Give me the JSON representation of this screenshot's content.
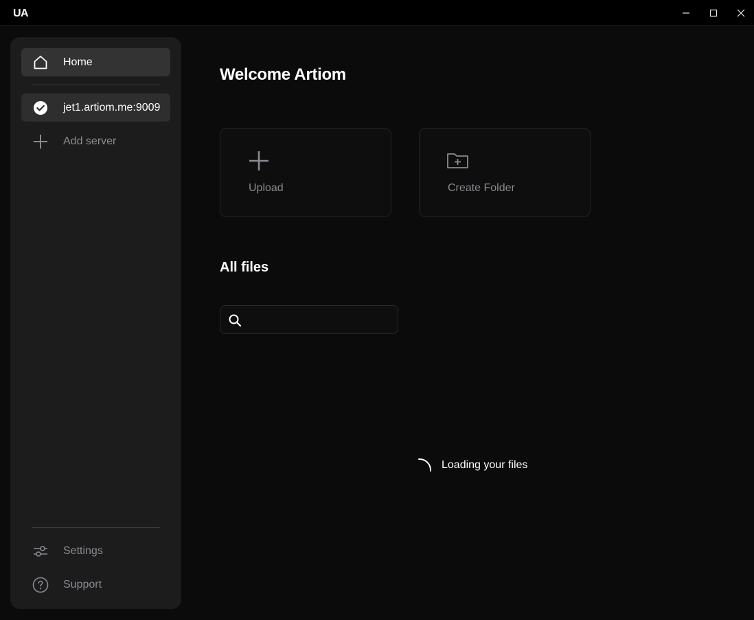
{
  "app": {
    "logo": "UA",
    "window_controls": [
      "minimize-icon",
      "maximize-icon",
      "close-icon"
    ]
  },
  "sidebar": {
    "home": {
      "label": "Home",
      "icon": "home-icon"
    },
    "servers": [
      {
        "label": "jet1.artiom.me:9009",
        "icon": "check-circle-icon",
        "selected": true
      }
    ],
    "add_server": {
      "label": "Add server",
      "icon": "plus-icon"
    },
    "settings": {
      "label": "Settings",
      "icon": "sliders-icon"
    },
    "support": {
      "label": "Support",
      "icon": "help-circle-icon"
    }
  },
  "main": {
    "welcome": "Welcome Artiom",
    "actions": [
      {
        "label": "Upload",
        "icon": "plus-icon"
      },
      {
        "label": "Create Folder",
        "icon": "folder-plus-icon"
      }
    ],
    "files_title": "All files",
    "search": {
      "placeholder": "",
      "value": "",
      "icon": "search-icon"
    },
    "loading_text": "Loading your files"
  },
  "colors": {
    "background": "#0b0b0b",
    "sidebar": "#1c1c1c",
    "active_item": "#333333",
    "muted_text": "#8a8a92"
  }
}
